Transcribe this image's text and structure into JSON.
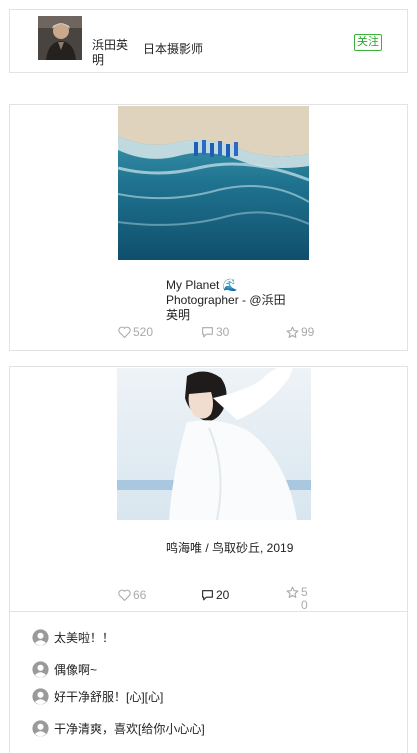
{
  "profile": {
    "name": "浜田英明",
    "description": "日本摄影师",
    "follow_label": "关注"
  },
  "posts": [
    {
      "caption": "My Planet 🌊 Photographer - @浜田英明",
      "likes": "520",
      "comments": "30",
      "favorites": "99"
    },
    {
      "caption": "鸣海唯 / 鸟取砂丘, 2019",
      "likes": "66",
      "comments": "20",
      "favorites": "50"
    }
  ],
  "comment_list": [
    {
      "text": "太美啦！！"
    },
    {
      "text": "偶像啊~"
    },
    {
      "text": "好干净舒服！[心][心]"
    },
    {
      "text": "干净清爽，喜欢[给你小心心]"
    }
  ],
  "colors": {
    "follow_green": "#2fa32f",
    "stat_gray": "#aaaaaa",
    "border": "#e3e3e3"
  },
  "icons": {
    "like": "heart-outline-icon",
    "comment": "speech-bubble-icon",
    "favorite": "star-outline-icon",
    "user": "user-avatar-icon"
  }
}
